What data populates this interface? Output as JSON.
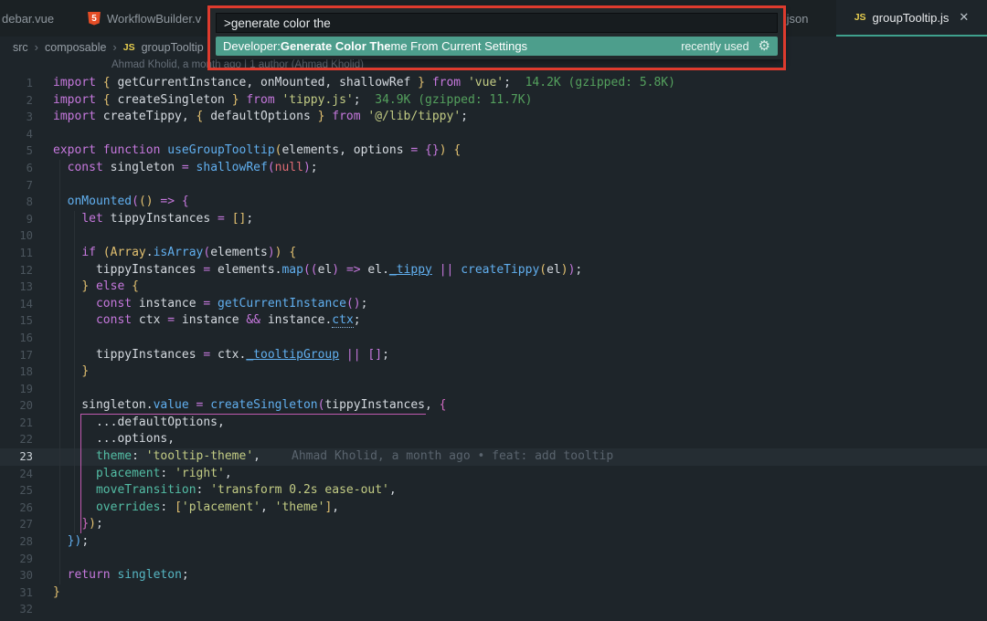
{
  "tabs": [
    {
      "label": "debar.vue"
    },
    {
      "label": "WorkflowBuilder.v",
      "icon": "html5",
      "icon_text": "5"
    },
    {
      "label": ".json"
    },
    {
      "label": "groupTooltip.js",
      "icon": "js",
      "icon_text": "JS",
      "close": "✕",
      "active": true
    }
  ],
  "breadcrumb": {
    "sep": "›",
    "items": [
      "src",
      "composable"
    ],
    "file": "groupTooltip",
    "file_icon": "JS"
  },
  "authors_lens": "Ahmad Kholid, a month ago | 1 author (Ahmad Kholid)",
  "palette": {
    "input_value": ">generate color the",
    "result": {
      "prefix": "Developer: ",
      "match": "Generate Color The",
      "suffix": "me From Current Settings",
      "badge": "recently used",
      "gear_icon": "⚙"
    },
    "highlight_color": "#4d9e8c",
    "annotation_color": "#de3b2e"
  },
  "colors": {
    "tab_underline": "#3fa18d",
    "editor_background": "#1e252a",
    "bracket_scope_guide": "#c05ab0"
  },
  "editor": {
    "lines": [
      {
        "n": 1,
        "tokens": [
          [
            "kw",
            "import"
          ],
          [
            "id",
            " "
          ],
          [
            "yel",
            "{"
          ],
          [
            "id",
            " getCurrentInstance, onMounted, shallowRef "
          ],
          [
            "yel",
            "}"
          ],
          [
            "id",
            " "
          ],
          [
            "kw",
            "from"
          ],
          [
            "id",
            " "
          ],
          [
            "str",
            "'vue'"
          ],
          [
            "id",
            ";"
          ],
          [
            "grn",
            "  14.2K (gzipped: 5.8K)"
          ]
        ]
      },
      {
        "n": 2,
        "tokens": [
          [
            "kw",
            "import"
          ],
          [
            "id",
            " "
          ],
          [
            "yel",
            "{"
          ],
          [
            "id",
            " createSingleton "
          ],
          [
            "yel",
            "}"
          ],
          [
            "id",
            " "
          ],
          [
            "kw",
            "from"
          ],
          [
            "id",
            " "
          ],
          [
            "str",
            "'tippy.js'"
          ],
          [
            "id",
            ";"
          ],
          [
            "grn",
            "  34.9K (gzipped: 11.7K)"
          ]
        ]
      },
      {
        "n": 3,
        "tokens": [
          [
            "kw",
            "import"
          ],
          [
            "id",
            " createTippy, "
          ],
          [
            "yel",
            "{"
          ],
          [
            "id",
            " defaultOptions "
          ],
          [
            "yel",
            "}"
          ],
          [
            "id",
            " "
          ],
          [
            "kw",
            "from"
          ],
          [
            "id",
            " "
          ],
          [
            "str",
            "'@/lib/tippy'"
          ],
          [
            "id",
            ";"
          ]
        ]
      },
      {
        "n": 4,
        "tokens": []
      },
      {
        "n": 5,
        "tokens": [
          [
            "kw",
            "export"
          ],
          [
            "id",
            " "
          ],
          [
            "kw",
            "function"
          ],
          [
            "id",
            " "
          ],
          [
            "fn",
            "useGroupTooltip"
          ],
          [
            "yel",
            "("
          ],
          [
            "id",
            "elements, options "
          ],
          [
            "kw",
            "="
          ],
          [
            "id",
            " "
          ],
          [
            "kw",
            "{}"
          ],
          [
            "yel",
            ")"
          ],
          [
            "id",
            " "
          ],
          [
            "yel",
            "{"
          ]
        ]
      },
      {
        "n": 6,
        "tokens": [
          [
            "id",
            "  "
          ],
          [
            "kw",
            "const"
          ],
          [
            "id",
            " singleton "
          ],
          [
            "kw",
            "="
          ],
          [
            "id",
            " "
          ],
          [
            "fn",
            "shallowRef"
          ],
          [
            "kw",
            "("
          ],
          [
            "red",
            "null"
          ],
          [
            "kw",
            ")"
          ],
          [
            "id",
            ";"
          ]
        ]
      },
      {
        "n": 7,
        "tokens": []
      },
      {
        "n": 8,
        "tokens": [
          [
            "id",
            "  "
          ],
          [
            "fn",
            "onMounted"
          ],
          [
            "kw",
            "("
          ],
          [
            "yel",
            "()"
          ],
          [
            "id",
            " "
          ],
          [
            "kw",
            "=>"
          ],
          [
            "id",
            " "
          ],
          [
            "kw",
            "{"
          ]
        ]
      },
      {
        "n": 9,
        "tokens": [
          [
            "id",
            "    "
          ],
          [
            "kw",
            "let"
          ],
          [
            "id",
            " tippyInstances "
          ],
          [
            "kw",
            "="
          ],
          [
            "id",
            " "
          ],
          [
            "yel",
            "[]"
          ],
          [
            "id",
            ";"
          ]
        ]
      },
      {
        "n": 10,
        "tokens": []
      },
      {
        "n": 11,
        "tokens": [
          [
            "id",
            "    "
          ],
          [
            "kw",
            "if"
          ],
          [
            "id",
            " "
          ],
          [
            "yel",
            "("
          ],
          [
            "yel",
            "Array"
          ],
          [
            "id",
            "."
          ],
          [
            "fn",
            "isArray"
          ],
          [
            "kw",
            "("
          ],
          [
            "id",
            "elements"
          ],
          [
            "kw",
            ")"
          ],
          [
            "yel",
            ")"
          ],
          [
            "id",
            " "
          ],
          [
            "yel",
            "{"
          ]
        ]
      },
      {
        "n": 12,
        "tokens": [
          [
            "id",
            "      tippyInstances "
          ],
          [
            "kw",
            "="
          ],
          [
            "id",
            " elements."
          ],
          [
            "fn",
            "map"
          ],
          [
            "kw",
            "(("
          ],
          [
            "id",
            "el"
          ],
          [
            "kw",
            ")"
          ],
          [
            "id",
            " "
          ],
          [
            "kw",
            "=>"
          ],
          [
            "id",
            " el."
          ],
          [
            "blueu",
            "_tippy"
          ],
          [
            "id",
            " "
          ],
          [
            "kw",
            "||"
          ],
          [
            "id",
            " "
          ],
          [
            "fn",
            "createTippy"
          ],
          [
            "yel",
            "("
          ],
          [
            "id",
            "el"
          ],
          [
            "yel",
            ")"
          ],
          [
            "kw",
            ")"
          ],
          [
            "id",
            ";"
          ]
        ]
      },
      {
        "n": 13,
        "tokens": [
          [
            "id",
            "    "
          ],
          [
            "yel",
            "}"
          ],
          [
            "id",
            " "
          ],
          [
            "kw",
            "else"
          ],
          [
            "id",
            " "
          ],
          [
            "yel",
            "{"
          ]
        ]
      },
      {
        "n": 14,
        "tokens": [
          [
            "id",
            "      "
          ],
          [
            "kw",
            "const"
          ],
          [
            "id",
            " instance "
          ],
          [
            "kw",
            "="
          ],
          [
            "id",
            " "
          ],
          [
            "fn",
            "getCurrentInstance"
          ],
          [
            "kw",
            "()"
          ],
          [
            "id",
            ";"
          ]
        ]
      },
      {
        "n": 15,
        "tokens": [
          [
            "id",
            "      "
          ],
          [
            "kw",
            "const"
          ],
          [
            "id",
            " ctx "
          ],
          [
            "kw",
            "="
          ],
          [
            "id",
            " instance "
          ],
          [
            "kw",
            "&&"
          ],
          [
            "id",
            " instance."
          ],
          [
            "dotu",
            "ctx"
          ],
          [
            "id",
            ";"
          ]
        ]
      },
      {
        "n": 16,
        "tokens": []
      },
      {
        "n": 17,
        "tokens": [
          [
            "id",
            "      tippyInstances "
          ],
          [
            "kw",
            "="
          ],
          [
            "id",
            " ctx."
          ],
          [
            "blueu",
            "_tooltipGroup"
          ],
          [
            "id",
            " "
          ],
          [
            "kw",
            "||"
          ],
          [
            "id",
            " "
          ],
          [
            "kw",
            "[]"
          ],
          [
            "id",
            ";"
          ]
        ]
      },
      {
        "n": 18,
        "tokens": [
          [
            "id",
            "    "
          ],
          [
            "yel",
            "}"
          ]
        ]
      },
      {
        "n": 19,
        "tokens": []
      },
      {
        "n": 20,
        "tokens": [
          [
            "id",
            "    singleton."
          ],
          [
            "fn",
            "value"
          ],
          [
            "id",
            " "
          ],
          [
            "kw",
            "="
          ],
          [
            "id",
            " "
          ],
          [
            "fn",
            "createSingleton"
          ],
          [
            "kw",
            "("
          ],
          [
            "id",
            "tippyInstances, "
          ],
          [
            "pink",
            "{"
          ]
        ]
      },
      {
        "n": 21,
        "tokens": [
          [
            "id",
            "      ...defaultOptions,"
          ]
        ]
      },
      {
        "n": 22,
        "tokens": [
          [
            "id",
            "      ...options,"
          ]
        ]
      },
      {
        "n": 23,
        "current": true,
        "tokens": [
          [
            "id",
            "      "
          ],
          [
            "prop",
            "theme"
          ],
          [
            "id",
            ": "
          ],
          [
            "str",
            "'tooltip-theme'"
          ],
          [
            "id",
            ","
          ]
        ],
        "blame": "Ahmad Kholid, a month ago • feat: add tooltip"
      },
      {
        "n": 24,
        "tokens": [
          [
            "id",
            "      "
          ],
          [
            "prop",
            "placement"
          ],
          [
            "id",
            ": "
          ],
          [
            "str",
            "'right'"
          ],
          [
            "id",
            ","
          ]
        ]
      },
      {
        "n": 25,
        "tokens": [
          [
            "id",
            "      "
          ],
          [
            "prop",
            "moveTransition"
          ],
          [
            "id",
            ": "
          ],
          [
            "str",
            "'transform 0.2s ease-out'"
          ],
          [
            "id",
            ","
          ]
        ]
      },
      {
        "n": 26,
        "tokens": [
          [
            "id",
            "      "
          ],
          [
            "prop",
            "overrides"
          ],
          [
            "id",
            ": "
          ],
          [
            "yel",
            "["
          ],
          [
            "str",
            "'placement'"
          ],
          [
            "id",
            ", "
          ],
          [
            "str",
            "'theme'"
          ],
          [
            "yel",
            "]"
          ],
          [
            "id",
            ","
          ]
        ]
      },
      {
        "n": 27,
        "tokens": [
          [
            "id",
            "    "
          ],
          [
            "pink",
            "}"
          ],
          [
            "yel",
            ")"
          ],
          [
            "id",
            ";"
          ]
        ]
      },
      {
        "n": 28,
        "tokens": [
          [
            "id",
            "  "
          ],
          [
            "fn",
            "})"
          ],
          [
            "id",
            ";"
          ]
        ]
      },
      {
        "n": 29,
        "tokens": []
      },
      {
        "n": 30,
        "tokens": [
          [
            "id",
            "  "
          ],
          [
            "kw",
            "return"
          ],
          [
            "id",
            " "
          ],
          [
            "cyan",
            "singleton"
          ],
          [
            "id",
            ";"
          ]
        ]
      },
      {
        "n": 31,
        "tokens": [
          [
            "yel",
            "}"
          ]
        ]
      },
      {
        "n": 32,
        "tokens": []
      }
    ]
  }
}
